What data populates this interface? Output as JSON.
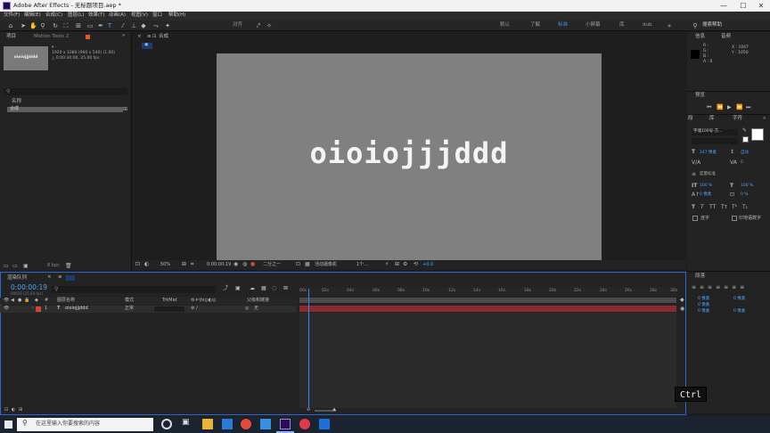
{
  "window": {
    "title": "Adobe After Effects - 无标题项目.aep *",
    "controls": [
      "—",
      "☐",
      "✕"
    ]
  },
  "menu": [
    "文件(F)",
    "编辑(E)",
    "合成(C)",
    "图层(L)",
    "效果(T)",
    "动画(A)",
    "视图(V)",
    "窗口",
    "帮助(H)"
  ],
  "toolbar": {
    "align_label": "对齐",
    "workspaces": [
      "默认",
      "了解",
      "标准",
      "小屏幕",
      "库",
      "dub"
    ],
    "active_workspace": "标准",
    "search_placeholder": "搜索帮助"
  },
  "project": {
    "tab_label": "项目",
    "tab2_label": "Motion Tools 2",
    "item_name": "oioiojjjddd",
    "item_info_1": "1920 x 1080 (960 x 540) (1.00)",
    "item_info_2": "△ 0:00:30:00, 25.00 fps",
    "column_name": "名称",
    "row_name": "合成",
    "bpc": "8 bpc"
  },
  "comp": {
    "tab_label": "合成",
    "sub_tab": "合成",
    "text": "oioiojjjddd",
    "zoom": "50%",
    "timecode": "0:00:00:19",
    "resolution": "二分之一",
    "camera": "活动摄像机",
    "views": "1个...",
    "exposure": "+0.0"
  },
  "info_panel": {
    "tab1": "信息",
    "tab2": "音频",
    "r": "R :",
    "g": "G :",
    "b": "B :",
    "a": "A : 0",
    "x": "X : 1047",
    "y": "Y : 1050"
  },
  "preview_panel": {
    "tab": "预览"
  },
  "character_panel": {
    "tab1": "段",
    "tab2": "库",
    "tab3": "字符",
    "font": "字魂100号-方...",
    "size": "147 像素",
    "leading": "自动",
    "tracking": "度量标准",
    "tracking_val": "0",
    "scale_v": "100 %",
    "scale_h": "100 %",
    "baseline": "0 像素",
    "tsume": "0 %",
    "ligatures": "连字",
    "hindi": "印地语数字"
  },
  "paragraph_panel": {
    "tab": "段落",
    "indent_1": "0 像素",
    "indent_2": "0 像素",
    "indent_3": "0 像素",
    "space_1": "0 像素",
    "space_2": "0 像素"
  },
  "timeline": {
    "tab_label": "渲染队列",
    "comp_tab": "合成",
    "timecode": "0:00:00:19",
    "timecode_sub": "00019 (25.00 fps)",
    "col_layer": "图层名称",
    "col_mode": "模式",
    "col_trkmat": "TrkMat",
    "col_parent": "父级和链接",
    "layer_index": "1",
    "layer_type": "T",
    "layer_name": "oioiojjjddd",
    "layer_mode": "正常",
    "layer_parent": "无",
    "ruler_ticks": [
      "00s",
      "02s",
      "04s",
      "06s",
      "08s",
      "10s",
      "12s",
      "14s",
      "16s",
      "18s",
      "20s",
      "22s",
      "24s",
      "26s",
      "28s",
      "30s"
    ]
  },
  "key_hint": "Ctrl",
  "taskbar": {
    "search_placeholder": "在这里输入你要搜索的内容"
  }
}
